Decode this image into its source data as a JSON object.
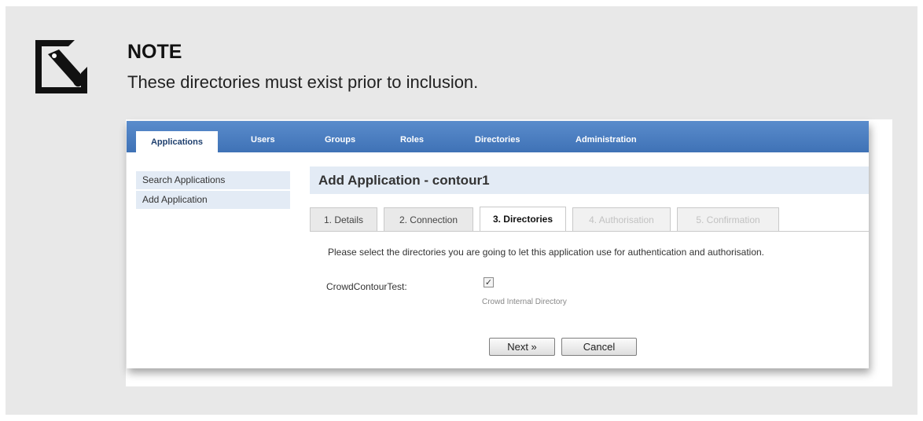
{
  "note": {
    "title": "NOTE",
    "text": "These directories must exist prior to inclusion.",
    "icon": "note-pencil-icon"
  },
  "app": {
    "navbar": {
      "items": [
        "Applications",
        "Users",
        "Groups",
        "Roles",
        "Directories",
        "Administration"
      ],
      "active": "Applications"
    },
    "sidebar": {
      "items": [
        "Search Applications",
        "Add Application"
      ]
    },
    "page_title": "Add Application - contour1",
    "wizard_tabs": [
      {
        "label": "1. Details",
        "state": "enabled"
      },
      {
        "label": "2. Connection",
        "state": "enabled"
      },
      {
        "label": "3. Directories",
        "state": "active"
      },
      {
        "label": "4. Authorisation",
        "state": "disabled"
      },
      {
        "label": "5. Confirmation",
        "state": "disabled"
      }
    ],
    "instruction": "Please select the directories you are going to let this application use for authentication and authorisation.",
    "directory": {
      "label": "CrowdContourTest:",
      "checked": true,
      "check_glyph": "✓",
      "type": "Crowd Internal Directory"
    },
    "buttons": {
      "next": "Next »",
      "cancel": "Cancel"
    }
  }
}
